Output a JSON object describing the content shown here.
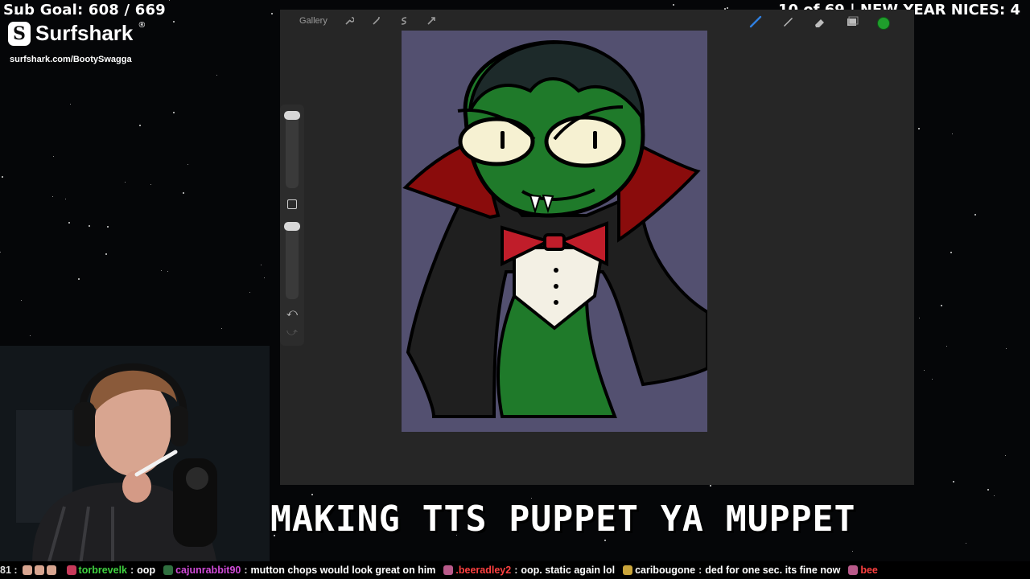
{
  "overlay": {
    "sub_goal": "Sub Goal: 608 / 669",
    "sponsor_name": "Surfshark",
    "sponsor_reg": "®",
    "sponsor_url": "surfshark.com/BootySwagga",
    "counter": "10 of 69 | NEW YEAR NICES: 4"
  },
  "app": {
    "gallery_label": "Gallery",
    "tool_icons": [
      "wrench-icon",
      "magic-wand-icon",
      "selection-icon",
      "transform-arrow-icon"
    ],
    "right_tool_icons": [
      "brush-icon",
      "smudge-icon",
      "eraser-icon",
      "layers-icon"
    ],
    "selected_color": "#1f9e2c",
    "undo_glyph": "⤺",
    "redo_glyph": "⤻"
  },
  "canvas": {
    "background": "#535070",
    "subject": "snake-vampire-illustration"
  },
  "stream_title": "MAKING TTS PUPPET YA MUPPET",
  "ticker": {
    "lead_fragment": "81 :",
    "messages": [
      {
        "user": "torbrevelk",
        "user_color": "#3fd23f",
        "text": "oop"
      },
      {
        "user": "cajunrabbit90",
        "user_color": "#d04bd8",
        "text": "mutton chops would look great on him"
      },
      {
        "user": ".beeradley2",
        "user_color": "#ff4040",
        "text": "oop. static again lol"
      },
      {
        "user": "caribougone",
        "user_color": "#ffffff",
        "text": "ded for one sec. its fine now"
      },
      {
        "user": "bee",
        "user_color": "#ff4040",
        "text": ""
      }
    ]
  }
}
